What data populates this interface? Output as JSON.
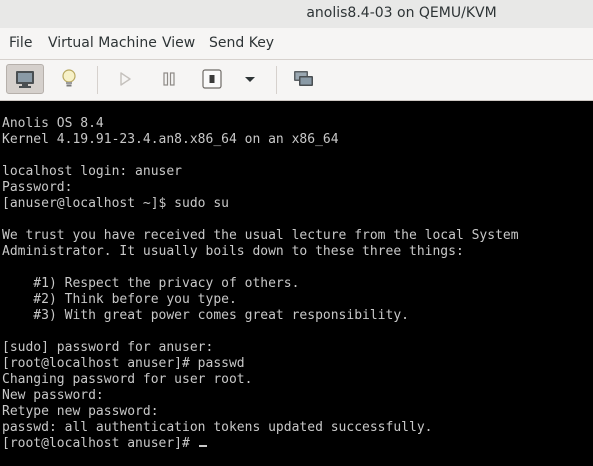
{
  "window": {
    "title": "anolis8.4-03 on QEMU/KVM"
  },
  "menu": {
    "items": [
      "File",
      "Virtual Machine",
      "View",
      "Send Key"
    ]
  },
  "toolbar": {
    "buttons": [
      {
        "icon": "monitor-icon",
        "state": "active"
      },
      {
        "icon": "lightbulb-icon",
        "state": "normal"
      },
      {
        "icon": "play-icon",
        "state": "disabled"
      },
      {
        "icon": "pause-icon",
        "state": "normal"
      },
      {
        "icon": "power-icon",
        "state": "normal"
      },
      {
        "icon": "chevron-down-icon",
        "state": "normal"
      },
      {
        "icon": "screens-icon",
        "state": "normal"
      }
    ]
  },
  "console": {
    "lines": [
      "",
      "Anolis OS 8.4",
      "Kernel 4.19.91-23.4.an8.x86_64 on an x86_64",
      "",
      "localhost login: anuser",
      "Password:",
      "[anuser@localhost ~]$ sudo su",
      "",
      "We trust you have received the usual lecture from the local System",
      "Administrator. It usually boils down to these three things:",
      "",
      "    #1) Respect the privacy of others.",
      "    #2) Think before you type.",
      "    #3) With great power comes great responsibility.",
      "",
      "[sudo] password for anuser:",
      "[root@localhost anuser]# passwd",
      "Changing password for user root.",
      "New password:",
      "Retype new password:",
      "passwd: all authentication tokens updated successfully.",
      "[root@localhost anuser]# "
    ]
  }
}
